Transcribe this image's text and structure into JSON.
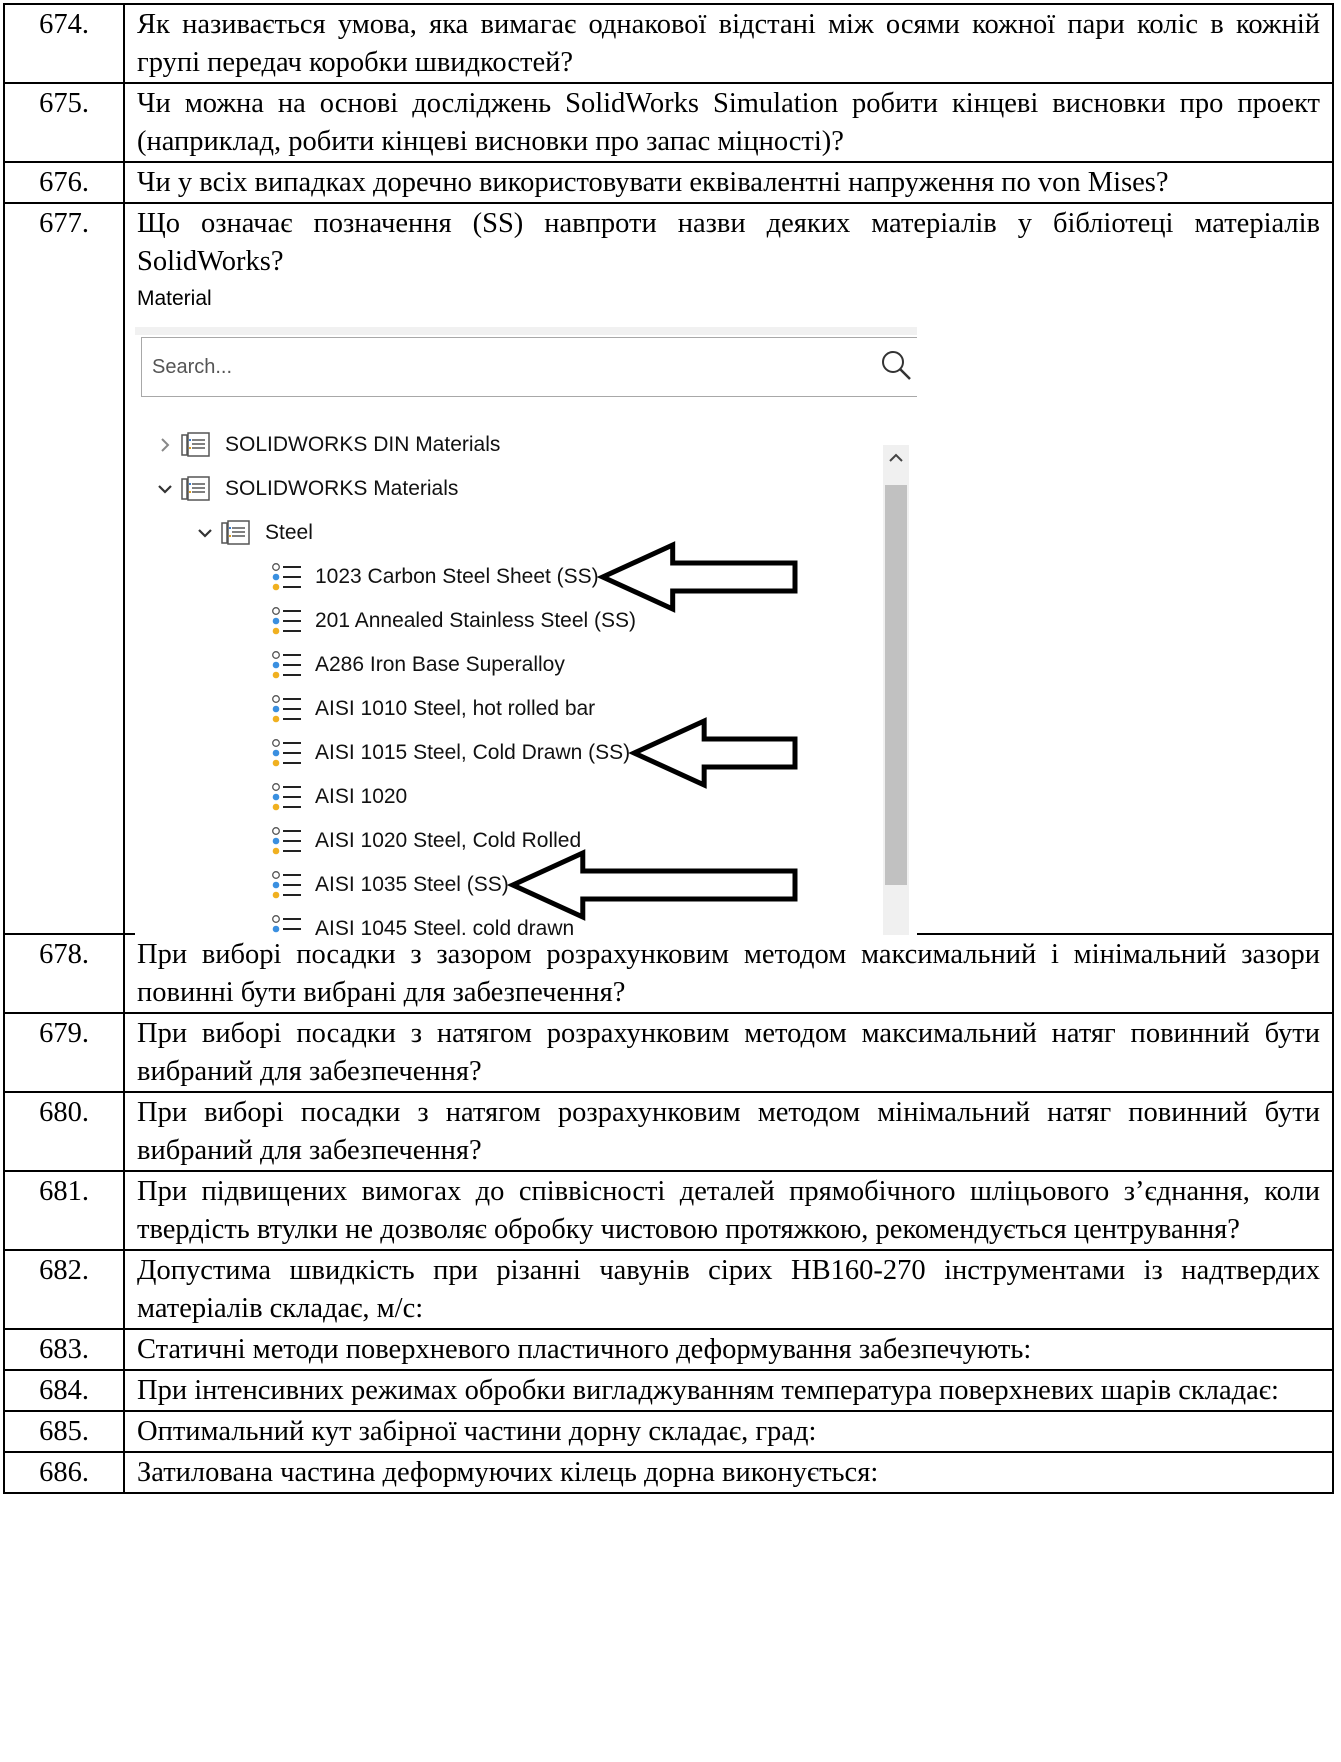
{
  "questions": [
    {
      "num": "674.",
      "text": "Як називається умова, яка вимагає однакової відстані між осями кожної пари коліс в кожній групі передач коробки швидкостей?"
    },
    {
      "num": "675.",
      "text": "Чи можна на основі досліджень SolidWorks Simulation робити кінцеві висновки про проект (наприклад, робити кінцеві висновки про запас міцності)?"
    },
    {
      "num": "676.",
      "text": "Чи у всіх випадках доречно використовувати еквівалентні напруження по von Mises?"
    },
    {
      "num": "677.",
      "text": "Що означає позначення (SS) навпроти назви деяких матеріалів у бібліотеці матеріалів SolidWorks?"
    },
    {
      "num": "678.",
      "text": "При виборі посадки з зазором розрахунковим методом максимальний і мінімальний зазори повинні бути вибрані для забезпечення?"
    },
    {
      "num": "679.",
      "text": "При виборі посадки з натягом розрахунковим методом максимальний натяг повинний бути вибраний для забезпечення?"
    },
    {
      "num": "680.",
      "text": "При виборі посадки з натягом розрахунковим методом мінімальний натяг повинний бути вибраний для забезпечення?"
    },
    {
      "num": "681.",
      "text": "При підвищених вимогах до співвісності деталей прямобічного шліцьового з’єднання, коли твердість втулки не дозволяє обробку чистовою протяжкою, рекомендується центрування?"
    },
    {
      "num": "682.",
      "text": "Допустима швидкість при різанні чавунів сірих НВ160-270 інструментами із надтвердих матеріалів складає, м/с:"
    },
    {
      "num": "683.",
      "text": "Статичні методи поверхневого пластичного деформування забезпечують:"
    },
    {
      "num": "684.",
      "text": "При інтенсивних режимах обробки вигладжуванням температура поверхневих шарів складає:"
    },
    {
      "num": "685.",
      "text": "Оптимальний кут забірної частини дорну складає, град:"
    },
    {
      "num": "686.",
      "text": "Затилована частина деформуючих кілець дорна виконується:"
    }
  ],
  "material_panel": {
    "label": "Material",
    "search_placeholder": "Search...",
    "tree": [
      {
        "label": "SOLIDWORKS DIN Materials",
        "chevron": "chevron-right-icon",
        "icon": "library-icon"
      },
      {
        "label": "SOLIDWORKS Materials",
        "chevron": "chevron-down-icon",
        "icon": "library-icon"
      },
      {
        "label": "Steel",
        "chevron": "chevron-down-icon",
        "icon": "library-icon"
      },
      {
        "label": "1023 Carbon Steel Sheet (SS)",
        "icon": "material-icon",
        "arrow": true
      },
      {
        "label": "201 Annealed Stainless Steel (SS)",
        "icon": "material-icon"
      },
      {
        "label": "A286 Iron Base Superalloy",
        "icon": "material-icon"
      },
      {
        "label": "AISI 1010 Steel, hot rolled bar",
        "icon": "material-icon"
      },
      {
        "label": "AISI 1015 Steel, Cold Drawn (SS)",
        "icon": "material-icon",
        "arrow": true
      },
      {
        "label": "AISI 1020",
        "icon": "material-icon"
      },
      {
        "label": "AISI 1020 Steel, Cold Rolled",
        "icon": "material-icon"
      },
      {
        "label": "AISI 1035 Steel (SS)",
        "icon": "material-icon",
        "arrow": true
      },
      {
        "label": "AISI 1045 Steel, cold drawn",
        "icon": "material-icon"
      }
    ]
  }
}
